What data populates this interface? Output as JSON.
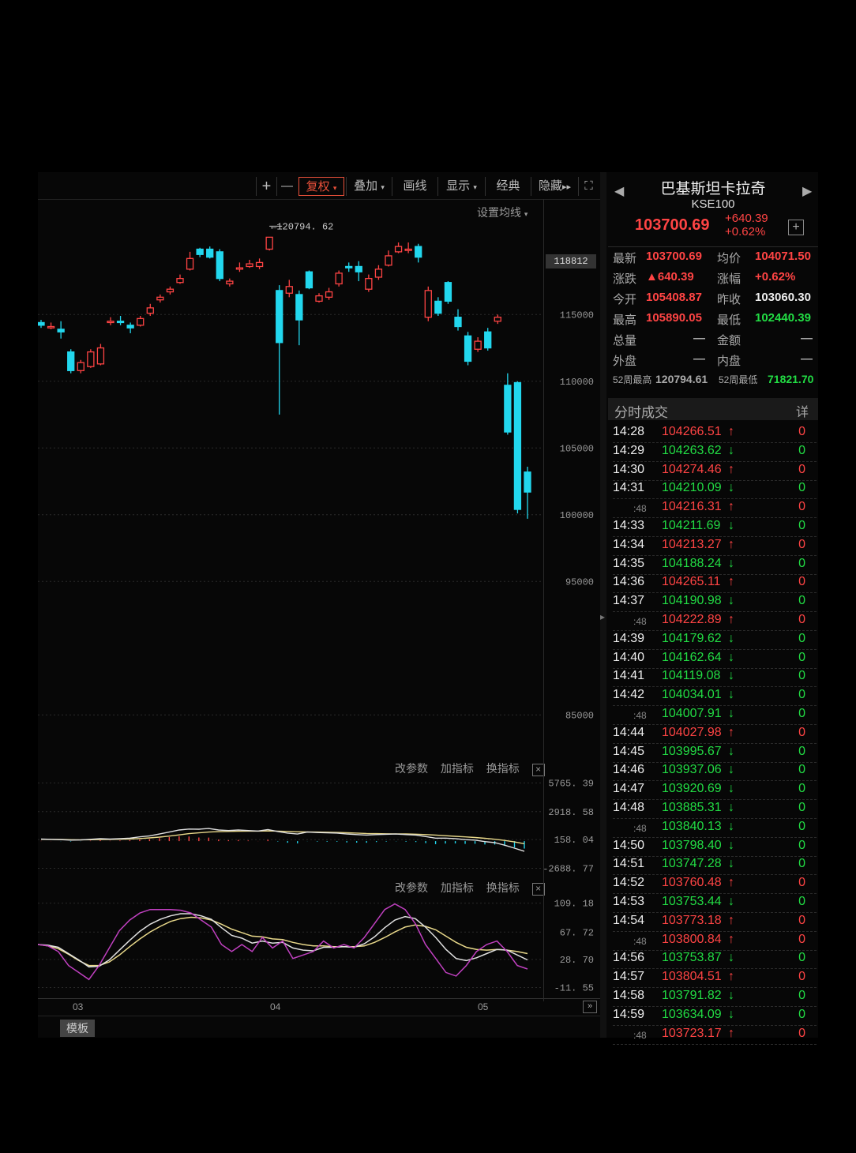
{
  "toolbar": {
    "plus": "+",
    "minus": "—",
    "buttons": [
      "复权",
      "叠加",
      "画线",
      "显示",
      "经典",
      "隐藏"
    ],
    "ma_setting": "设置均线"
  },
  "chart": {
    "high_label": "120794. 62",
    "price_badge": "118812",
    "y_labels": [
      "115000",
      "110000",
      "105000",
      "100000",
      "95000",
      "85000"
    ],
    "x_labels": [
      "03",
      "04",
      "05"
    ],
    "template_btn": "模板"
  },
  "indicator_panes": [
    {
      "actions": [
        "改参数",
        "加指标",
        "换指标"
      ],
      "close": "×",
      "y_labels": [
        "5765. 39",
        "2918. 58",
        "158. 04",
        "-2688. 77"
      ]
    },
    {
      "actions": [
        "改参数",
        "加指标",
        "换指标"
      ],
      "close": "×",
      "y_labels": [
        "109. 18",
        "67. 72",
        "28. 70",
        "-11. 55"
      ]
    }
  ],
  "quote": {
    "name": "巴基斯坦卡拉奇",
    "code": "KSE100",
    "last": "103700.69",
    "change": "+640.39",
    "change_pct": "+0.62%",
    "add": "+",
    "rows": [
      [
        "最新",
        "103700.69",
        "均价",
        "104071.50"
      ],
      [
        "涨跌",
        "▲640.39",
        "涨幅",
        "+0.62%"
      ],
      [
        "今开",
        "105408.87",
        "昨收",
        "103060.30"
      ],
      [
        "最高",
        "105890.05",
        "最低",
        "102440.39"
      ],
      [
        "总量",
        "—",
        "金额",
        "—"
      ],
      [
        "外盘",
        "—",
        "内盘",
        "—"
      ],
      [
        "52周最高",
        "120794.61",
        "52周最低",
        "71821.70"
      ]
    ],
    "colors": {
      "up": "#ff4444",
      "down": "#22dd44"
    }
  },
  "trades": {
    "title": "分时成交",
    "detail": "详",
    "rows": [
      {
        "time": "14:28",
        "price": "104266.51",
        "dir": "up",
        "vol": "0"
      },
      {
        "time": "14:29",
        "price": "104263.62",
        "dir": "down",
        "vol": "0"
      },
      {
        "time": "14:30",
        "price": "104274.46",
        "dir": "up",
        "vol": "0"
      },
      {
        "time": "14:31",
        "price": "104210.09",
        "dir": "down",
        "vol": "0"
      },
      {
        "time": ":48",
        "price": "104216.31",
        "dir": "up",
        "vol": "0"
      },
      {
        "time": "14:33",
        "price": "104211.69",
        "dir": "down",
        "vol": "0"
      },
      {
        "time": "14:34",
        "price": "104213.27",
        "dir": "up",
        "vol": "0"
      },
      {
        "time": "14:35",
        "price": "104188.24",
        "dir": "down",
        "vol": "0"
      },
      {
        "time": "14:36",
        "price": "104265.11",
        "dir": "up",
        "vol": "0"
      },
      {
        "time": "14:37",
        "price": "104190.98",
        "dir": "down",
        "vol": "0"
      },
      {
        "time": ":48",
        "price": "104222.89",
        "dir": "up",
        "vol": "0"
      },
      {
        "time": "14:39",
        "price": "104179.62",
        "dir": "down",
        "vol": "0"
      },
      {
        "time": "14:40",
        "price": "104162.64",
        "dir": "down",
        "vol": "0"
      },
      {
        "time": "14:41",
        "price": "104119.08",
        "dir": "down",
        "vol": "0"
      },
      {
        "time": "14:42",
        "price": "104034.01",
        "dir": "down",
        "vol": "0"
      },
      {
        "time": ":48",
        "price": "104007.91",
        "dir": "down",
        "vol": "0"
      },
      {
        "time": "14:44",
        "price": "104027.98",
        "dir": "up",
        "vol": "0"
      },
      {
        "time": "14:45",
        "price": "103995.67",
        "dir": "down",
        "vol": "0"
      },
      {
        "time": "14:46",
        "price": "103937.06",
        "dir": "down",
        "vol": "0"
      },
      {
        "time": "14:47",
        "price": "103920.69",
        "dir": "down",
        "vol": "0"
      },
      {
        "time": "14:48",
        "price": "103885.31",
        "dir": "down",
        "vol": "0"
      },
      {
        "time": ":48",
        "price": "103840.13",
        "dir": "down",
        "vol": "0"
      },
      {
        "time": "14:50",
        "price": "103798.40",
        "dir": "down",
        "vol": "0"
      },
      {
        "time": "14:51",
        "price": "103747.28",
        "dir": "down",
        "vol": "0"
      },
      {
        "time": "14:52",
        "price": "103760.48",
        "dir": "up",
        "vol": "0"
      },
      {
        "time": "14:53",
        "price": "103753.44",
        "dir": "down",
        "vol": "0"
      },
      {
        "time": "14:54",
        "price": "103773.18",
        "dir": "up",
        "vol": "0"
      },
      {
        "time": ":48",
        "price": "103800.84",
        "dir": "up",
        "vol": "0"
      },
      {
        "time": "14:56",
        "price": "103753.87",
        "dir": "down",
        "vol": "0"
      },
      {
        "time": "14:57",
        "price": "103804.51",
        "dir": "up",
        "vol": "0"
      },
      {
        "time": "14:58",
        "price": "103791.82",
        "dir": "down",
        "vol": "0"
      },
      {
        "time": "14:59",
        "price": "103634.09",
        "dir": "down",
        "vol": "0"
      },
      {
        "time": ":48",
        "price": "103723.17",
        "dir": "up",
        "vol": "0"
      }
    ]
  },
  "chart_data": {
    "type": "candlestick",
    "price_ylim": [
      82000,
      122000
    ],
    "high_marker": 120794.62,
    "candles": [
      [
        114400,
        114200,
        114600,
        114000
      ],
      [
        114000,
        114100,
        114400,
        113900
      ],
      [
        113900,
        113700,
        114500,
        113200
      ],
      [
        112200,
        110800,
        112400,
        110600
      ],
      [
        110800,
        111400,
        111600,
        110600
      ],
      [
        111100,
        112200,
        112400,
        111000
      ],
      [
        111300,
        112500,
        112800,
        111200
      ],
      [
        114400,
        114500,
        114800,
        114200
      ],
      [
        114500,
        114400,
        114900,
        114200
      ],
      [
        114200,
        114000,
        114400,
        113600
      ],
      [
        114200,
        114700,
        114900,
        114100
      ],
      [
        115100,
        115500,
        115800,
        114900
      ],
      [
        116100,
        116300,
        116500,
        115900
      ],
      [
        116700,
        116900,
        117100,
        116500
      ],
      [
        117400,
        117700,
        118000,
        117300
      ],
      [
        118400,
        119200,
        119700,
        118300
      ],
      [
        119900,
        119500,
        120000,
        119300
      ],
      [
        119900,
        119300,
        120100,
        119200
      ],
      [
        119700,
        117700,
        119900,
        117500
      ],
      [
        117300,
        117500,
        117700,
        117100
      ],
      [
        118400,
        118500,
        118900,
        118200
      ],
      [
        118600,
        118800,
        119100,
        118500
      ],
      [
        118600,
        118900,
        119200,
        118400
      ],
      [
        119900,
        120794.62,
        120794.62,
        119800
      ],
      [
        116800,
        112900,
        117200,
        107500
      ],
      [
        116600,
        117100,
        117600,
        116300
      ],
      [
        116500,
        114600,
        116800,
        112700
      ],
      [
        118200,
        117000,
        118300,
        116900
      ],
      [
        116000,
        116400,
        116600,
        115900
      ],
      [
        116300,
        116700,
        117000,
        116100
      ],
      [
        117300,
        118100,
        118300,
        117100
      ],
      [
        118600,
        118500,
        118900,
        118200
      ],
      [
        118600,
        118200,
        119000,
        117500
      ],
      [
        116900,
        117700,
        118000,
        116700
      ],
      [
        117800,
        118400,
        118700,
        117600
      ],
      [
        118700,
        119400,
        119800,
        118600
      ],
      [
        119700,
        120100,
        120400,
        119600
      ],
      [
        119800,
        119900,
        120400,
        119600
      ],
      [
        120100,
        119300,
        120300,
        118900
      ],
      [
        114800,
        116800,
        117100,
        114500
      ],
      [
        116000,
        115100,
        116300,
        114900
      ],
      [
        117400,
        116000,
        117500,
        115800
      ],
      [
        114800,
        114100,
        115400,
        113800
      ],
      [
        113400,
        111500,
        113700,
        111200
      ],
      [
        112400,
        113000,
        113300,
        112200
      ],
      [
        113700,
        112500,
        114000,
        112300
      ],
      [
        114500,
        114800,
        115000,
        114300
      ],
      [
        109700,
        106200,
        110600,
        106000
      ],
      [
        109900,
        100400,
        110000,
        100100
      ],
      [
        103200,
        101700,
        103600,
        99700
      ]
    ],
    "macd_panel": {
      "ylabels": [
        5765.39,
        2918.58,
        158.04,
        -2688.77
      ],
      "dif": [
        200,
        180,
        150,
        100,
        120,
        180,
        240,
        200,
        250,
        300,
        420,
        520,
        700,
        900,
        1100,
        1200,
        1180,
        1250,
        1100,
        1050,
        1100,
        1050,
        1000,
        1150,
        950,
        800,
        700,
        900,
        850,
        820,
        800,
        700,
        650,
        600,
        650,
        680,
        700,
        650,
        600,
        450,
        300,
        300,
        250,
        150,
        100,
        -50,
        -150,
        -400,
        -700,
        -1000
      ],
      "dea": [
        180,
        170,
        160,
        140,
        130,
        140,
        160,
        170,
        190,
        210,
        260,
        320,
        400,
        500,
        620,
        740,
        820,
        900,
        940,
        960,
        980,
        990,
        990,
        1010,
        990,
        960,
        920,
        910,
        900,
        880,
        860,
        830,
        800,
        760,
        740,
        730,
        720,
        710,
        690,
        650,
        600,
        540,
        480,
        420,
        360,
        280,
        190,
        70,
        -80,
        -260
      ],
      "hist": [
        40,
        20,
        -20,
        -80,
        -20,
        80,
        160,
        60,
        120,
        180,
        320,
        400,
        600,
        800,
        960,
        920,
        720,
        700,
        320,
        180,
        240,
        120,
        20,
        280,
        -80,
        -320,
        -440,
        -20,
        -100,
        -120,
        -120,
        -260,
        -300,
        -320,
        -180,
        -100,
        -40,
        -120,
        -180,
        -400,
        -600,
        -480,
        -460,
        -540,
        -520,
        -660,
        -680,
        -940,
        -1240,
        -1480
      ]
    },
    "osc_panel": {
      "ylabels": [
        109.18,
        67.72,
        28.7,
        -11.55
      ],
      "k": [
        50,
        48,
        40,
        20,
        10,
        0,
        20,
        45,
        70,
        85,
        95,
        100,
        100,
        100,
        99,
        95,
        85,
        75,
        50,
        40,
        50,
        40,
        60,
        45,
        55,
        30,
        35,
        40,
        55,
        45,
        50,
        45,
        60,
        80,
        100,
        108,
        100,
        80,
        50,
        30,
        10,
        5,
        20,
        40,
        50,
        55,
        40,
        20,
        15
      ],
      "d": [
        50,
        49,
        46,
        37,
        28,
        18,
        19,
        28,
        42,
        56,
        69,
        79,
        86,
        91,
        94,
        94,
        91,
        86,
        74,
        63,
        59,
        52,
        55,
        52,
        53,
        45,
        42,
        41,
        46,
        46,
        47,
        46,
        51,
        61,
        74,
        85,
        90,
        87,
        75,
        60,
        43,
        30,
        27,
        31,
        37,
        43,
        42,
        35,
        28
      ],
      "j": [
        50,
        48,
        44,
        36,
        27,
        20,
        20,
        25,
        35,
        47,
        58,
        68,
        76,
        83,
        87,
        89,
        88,
        85,
        79,
        72,
        67,
        62,
        61,
        58,
        57,
        53,
        50,
        48,
        48,
        47,
        47,
        47,
        48,
        53,
        60,
        68,
        75,
        78,
        76,
        71,
        62,
        53,
        46,
        43,
        42,
        43,
        42,
        40,
        37
      ]
    }
  }
}
